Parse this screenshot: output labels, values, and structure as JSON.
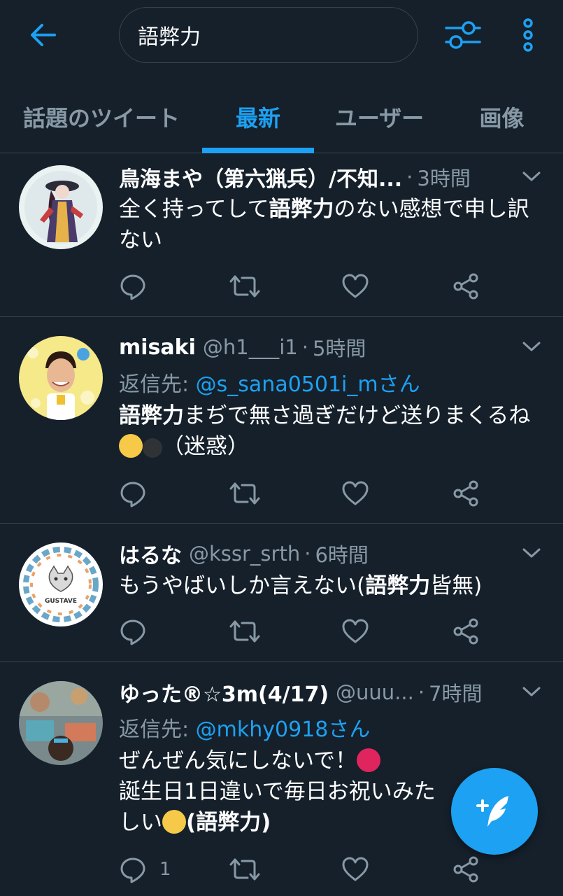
{
  "colors": {
    "background": "#15202b",
    "accent": "#1da1f2",
    "muted": "#8899a6",
    "divider": "#38444d"
  },
  "topbar": {
    "back_icon": "arrow-left-icon",
    "search_value": "語弊力",
    "filter_icon": "sliders-icon",
    "more_icon": "vertical-dots-icon"
  },
  "tabs": [
    {
      "label": "話題のツイート",
      "active": false
    },
    {
      "label": "最新",
      "active": true
    },
    {
      "label": "ユーザー",
      "active": false
    },
    {
      "label": "画像",
      "active": false
    }
  ],
  "tweets": [
    {
      "name": "鳥海まや（第六猟兵）/不知...",
      "handle": "",
      "time": "3時間",
      "reply_prefix": "",
      "reply_to": "",
      "body_before": "全く持ってして",
      "body_bold": "語弊力",
      "body_after": "のない感想で申し訳ない",
      "reply_count": ""
    },
    {
      "name": "misaki",
      "handle": "@h1___i1",
      "time": "5時間",
      "reply_prefix": "返信先: ",
      "reply_to": "@s_sana0501i_mさん",
      "body_before": "",
      "body_bold": "語弊力",
      "body_after": "まぢで無さ過ぎだけど送りまくるね",
      "body_tail": "（迷惑）",
      "reply_count": ""
    },
    {
      "name": "はるな",
      "handle": "@kssr_srth",
      "time": "6時間",
      "reply_prefix": "",
      "reply_to": "",
      "body_before": "もうやばいしか言えない(",
      "body_bold": "語弊力",
      "body_after": "皆無)",
      "reply_count": "",
      "avatar_brand": "GUSTAVE"
    },
    {
      "name": "ゆった®☆3m(4/17)",
      "handle": "@uuu...",
      "time": "7時間",
      "reply_prefix": "返信先: ",
      "reply_to": "@mkhy0918さん",
      "body_line1": "ぜんぜん気にしないで！",
      "body_line2": "誕生日1日違いで毎日お祝いみた",
      "body_line3_before": "しい",
      "body_line3_bold": "(語弊力)",
      "reply_count": "1"
    }
  ],
  "fab": {
    "icon": "compose-tweet-icon"
  }
}
